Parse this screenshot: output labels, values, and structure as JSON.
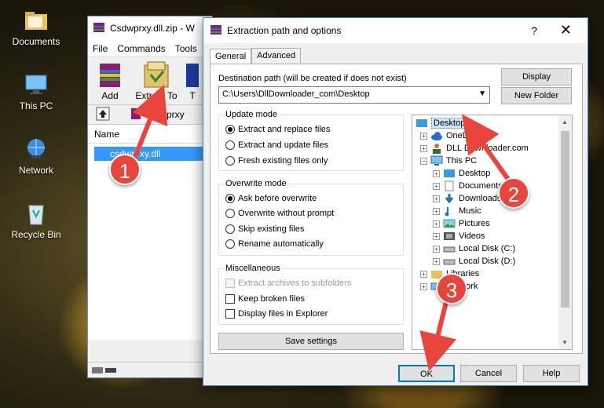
{
  "desktop": {
    "icons": [
      {
        "label": "Documents",
        "icon": "folder-icon"
      },
      {
        "label": "This PC",
        "icon": "computer-icon"
      },
      {
        "label": "Network",
        "icon": "network-icon"
      },
      {
        "label": "Recycle Bin",
        "icon": "recycle-bin-icon"
      }
    ]
  },
  "winrar": {
    "title": "Csdwprxy.dll.zip - W",
    "menu": [
      "File",
      "Commands",
      "Tools"
    ],
    "toolbar": {
      "add": "Add",
      "extract_to": "Extract To",
      "third": "T"
    },
    "address": "Csdwprxy",
    "column_name": "Name",
    "file": "csdwprxy.dll"
  },
  "dialog": {
    "title": "Extraction path and options",
    "help": "?",
    "close": "✕",
    "tabs": [
      "General",
      "Advanced"
    ],
    "dest_label": "Destination path (will be created if does not exist)",
    "dest_value": "C:\\Users\\DllDownloader_com\\Desktop",
    "display_btn": "Display",
    "new_folder_btn": "New Folder",
    "update_mode": {
      "title": "Update mode",
      "options": [
        "Extract and replace files",
        "Extract and update files",
        "Fresh existing files only"
      ],
      "selected": 0
    },
    "overwrite_mode": {
      "title": "Overwrite mode",
      "options": [
        "Ask before overwrite",
        "Overwrite without prompt",
        "Skip existing files",
        "Rename automatically"
      ],
      "selected": 0
    },
    "misc": {
      "title": "Miscellaneous",
      "options": [
        "Extract archives to subfolders",
        "Keep broken files",
        "Display files in Explorer"
      ]
    },
    "save_settings": "Save settings",
    "tree": [
      {
        "label": "Desktop",
        "selected": true
      },
      {
        "label": "OneDrive"
      },
      {
        "label": "DLL Downloader.com"
      },
      {
        "label": "This PC"
      },
      {
        "label": "Desktop"
      },
      {
        "label": "Documents"
      },
      {
        "label": "Downloads"
      },
      {
        "label": "Music"
      },
      {
        "label": "Pictures"
      },
      {
        "label": "Videos"
      },
      {
        "label": "Local Disk (C:)"
      },
      {
        "label": "Local Disk (D:)"
      },
      {
        "label": "Libraries"
      },
      {
        "label": "Network"
      }
    ],
    "ok": "OK",
    "cancel": "Cancel",
    "help_btn": "Help"
  },
  "steps": [
    "1",
    "2",
    "3"
  ],
  "colors": {
    "accent": "#3399ff",
    "step_badge": "#e8453c",
    "selection": "#cce8ff"
  }
}
